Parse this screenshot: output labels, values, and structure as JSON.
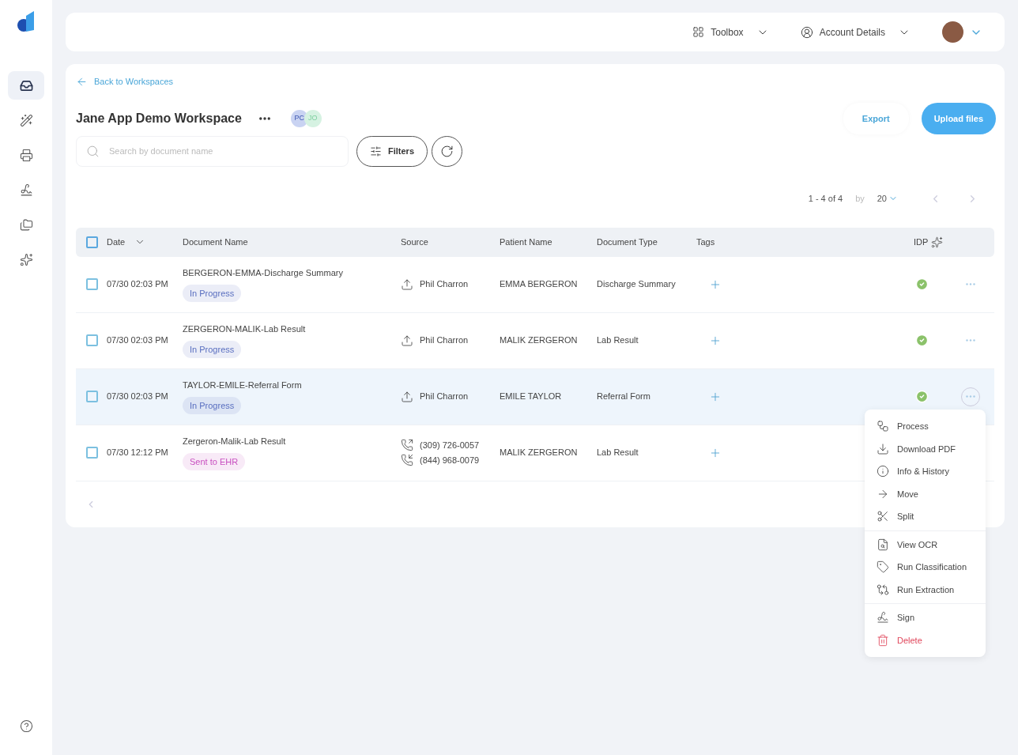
{
  "sidebar": {
    "items": [
      {
        "kind": "inbox",
        "selected": true
      },
      {
        "kind": "wand",
        "selected": false
      },
      {
        "kind": "fax",
        "selected": false
      },
      {
        "kind": "sign",
        "selected": false
      },
      {
        "kind": "folders",
        "selected": false
      },
      {
        "kind": "sparkle",
        "selected": false
      }
    ]
  },
  "header": {
    "toolbox": "Toolbox",
    "account": "Account Details"
  },
  "back_link": "Back to Workspaces",
  "workspace": {
    "title": "Jane App Demo Workspace",
    "members": [
      {
        "initials": "PC",
        "color": "#c9d3f2"
      },
      {
        "initials": "JO",
        "color": "#d6f2e2"
      }
    ]
  },
  "actions": {
    "export": "Export",
    "upload": "Upload files"
  },
  "search": {
    "placeholder": "Search by document name"
  },
  "filters": "Filters",
  "pagination": {
    "range": "1 - 4 of 4",
    "by": "by",
    "page_size": "20"
  },
  "table": {
    "select_all_checked": false,
    "columns": [
      "Date",
      "Document Name",
      "Source",
      "Patient Name",
      "Document Type",
      "Tags",
      "IDP"
    ],
    "rows": [
      {
        "checked": false,
        "date": "07/30 02:03 PM",
        "name": "BERGERON-EMMA-Discharge Summary",
        "status": {
          "label": "In Progress",
          "color": "#5a6fc0"
        },
        "source": {
          "kind": "upload",
          "lines": [
            "Phil Charron"
          ]
        },
        "patient": "EMMA BERGERON",
        "type": "Discharge Summary",
        "hovered": false
      },
      {
        "checked": false,
        "date": "07/30 02:03 PM",
        "name": "ZERGERON-MALIK-Lab Result",
        "status": {
          "label": "In Progress",
          "color": "#5a6fc0"
        },
        "source": {
          "kind": "upload",
          "lines": [
            "Phil Charron"
          ]
        },
        "patient": "MALIK ZERGERON",
        "type": "Lab Result",
        "hovered": false
      },
      {
        "checked": false,
        "date": "07/30 02:03 PM",
        "name": "TAYLOR-EMILE-Referral Form",
        "status": {
          "label": "In Progress",
          "color": "#5a6fc0"
        },
        "source": {
          "kind": "upload",
          "lines": [
            "Phil Charron"
          ]
        },
        "patient": "EMILE TAYLOR",
        "type": "Referral Form",
        "hovered": true
      },
      {
        "checked": false,
        "date": "07/30 12:12 PM",
        "name": "Zergeron-Malik-Lab Result",
        "status": {
          "label": "Sent to EHR",
          "color": "#c84fc0"
        },
        "source": {
          "kind": "phone",
          "lines": [
            "(309) 726-0057",
            "(844) 968-0079"
          ]
        },
        "patient": "MALIK ZERGERON",
        "type": "Lab Result"
      }
    ]
  },
  "menu": {
    "groups": [
      [
        {
          "kind": "process",
          "label": "Process"
        },
        {
          "kind": "download",
          "label": "Download PDF"
        },
        {
          "kind": "info",
          "label": "Info & History"
        },
        {
          "kind": "move",
          "label": "Move"
        },
        {
          "kind": "split",
          "label": "Split"
        }
      ],
      [
        {
          "kind": "ocr",
          "label": "View OCR"
        },
        {
          "kind": "tag",
          "label": "Run Classification"
        },
        {
          "kind": "extract",
          "label": "Run Extraction"
        }
      ],
      [
        {
          "kind": "sign",
          "label": "Sign"
        },
        {
          "kind": "delete",
          "label": "Delete"
        }
      ]
    ]
  }
}
